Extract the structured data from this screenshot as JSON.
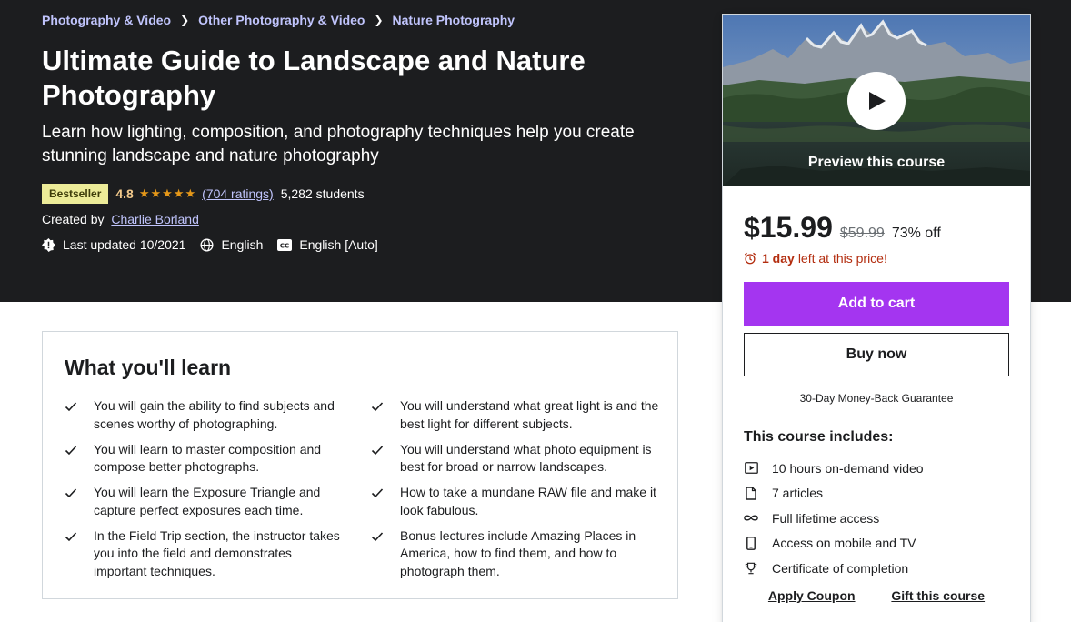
{
  "breadcrumb": [
    "Photography & Video",
    "Other Photography & Video",
    "Nature Photography"
  ],
  "course": {
    "title": "Ultimate Guide to Landscape and Nature Photography",
    "subtitle": "Learn how lighting, composition, and photography techniques help you create stunning landscape and nature photography",
    "badge": "Bestseller",
    "rating": "4.8",
    "stars": "★★★★★",
    "ratings_count": "(704 ratings)",
    "students": "5,282 students",
    "created_by_label": "Created by",
    "author": "Charlie Borland",
    "last_updated": "Last updated 10/2021",
    "language": "English",
    "captions": "English [Auto]"
  },
  "sidebar": {
    "preview_label": "Preview this course",
    "price": "$15.99",
    "original_price": "$59.99",
    "discount": "73% off",
    "timer_bold": "1 day",
    "timer_text": "left at this price!",
    "add_to_cart": "Add to cart",
    "buy_now": "Buy now",
    "guarantee": "30-Day Money-Back Guarantee",
    "includes_title": "This course includes:",
    "includes": [
      {
        "icon": "video-icon",
        "label": "10 hours on-demand video"
      },
      {
        "icon": "file-icon",
        "label": "7 articles"
      },
      {
        "icon": "infinity-icon",
        "label": "Full lifetime access"
      },
      {
        "icon": "mobile-icon",
        "label": "Access on mobile and TV"
      },
      {
        "icon": "trophy-icon",
        "label": "Certificate of completion"
      }
    ],
    "apply_coupon": "Apply Coupon",
    "gift_course": "Gift this course"
  },
  "learn": {
    "title": "What you'll learn",
    "items": [
      "You will gain the ability to find subjects and scenes worthy of photographing.",
      "You will understand what great light is and the best light for different subjects.",
      "You will learn to master composition and compose better photographs.",
      "You will understand what photo equipment is best for broad or narrow landscapes.",
      "You will learn the Exposure Triangle and capture perfect exposures each time.",
      "How to take a mundane RAW file and make it look fabulous.",
      "In the Field Trip section, the instructor takes you into the field and demonstrates important techniques.",
      "Bonus lectures include Amazing Places in America, how to find them, and how to photograph them."
    ]
  },
  "colors": {
    "hero_bg": "#1c1d1f",
    "accent_purple": "#a435f0",
    "link_lavender": "#c0c4fc",
    "badge_bg": "#eceb98",
    "star": "#e59819",
    "timer_red": "#b32d0f"
  }
}
